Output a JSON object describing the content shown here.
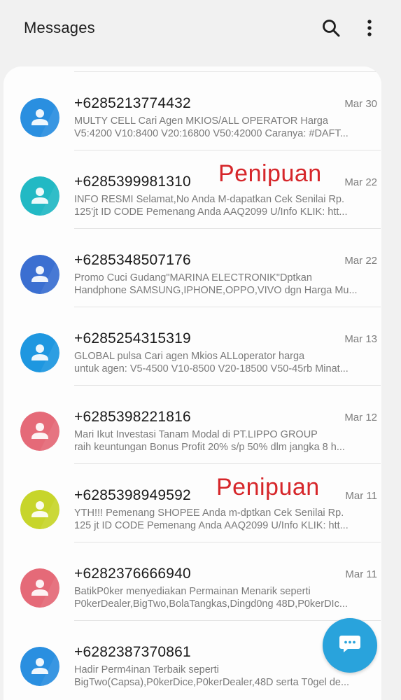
{
  "header": {
    "title": "Messages",
    "search_icon": "search-icon",
    "more_icon": "more-options-icon"
  },
  "conversations": [
    {
      "sender": "+6285213774432",
      "date": "Mar 30",
      "preview_line1": "MULTY CELL Cari Agen MKIOS/ALL OPERATOR Harga",
      "preview_line2": "V5:4200 V10:8400 V20:16800 V50:42000 Caranya: #DAFT...",
      "avatar_color": "#2a8fe0",
      "annotation": ""
    },
    {
      "sender": "+6285399981310",
      "date": "Mar 22",
      "preview_line1": "INFO RESMI Selamat,No Anda M-dapatkan Cek Senilai Rp.",
      "preview_line2": "125'jt ID CODE Pemenang Anda AAQ2099 U/Info KLIK: htt...",
      "avatar_color": "#22b9c4",
      "annotation": "Penipuan"
    },
    {
      "sender": "+6285348507176",
      "date": "Mar 22",
      "preview_line1": "Promo Cuci Gudang\"MARINA ELECTRONIK\"Dptkan",
      "preview_line2": "Handphone SAMSUNG,IPHONE,OPPO,VIVO dgn Harga Mu...",
      "avatar_color": "#3b6fd1",
      "annotation": ""
    },
    {
      "sender": "+6285254315319",
      "date": "Mar 13",
      "preview_line1": "GLOBAL pulsa Cari agen Mkios  ALLoperator harga",
      "preview_line2": "untuk agen: V5-4500 V10-8500 V20-18500 V50-45rb Minat...",
      "avatar_color": "#1e97e0",
      "annotation": ""
    },
    {
      "sender": "+6285398221816",
      "date": "Mar 12",
      "preview_line1": "Mari Ikut Investasi Tanam Modal di PT.LIPPO GROUP",
      "preview_line2": "raih keuntungan Bonus Profit 20% s/p 50% dlm jangka 8 h...",
      "avatar_color": "#e56a78",
      "annotation": ""
    },
    {
      "sender": "+6285398949592",
      "date": "Mar 11",
      "preview_line1": "YTH!!! Pemenang SHOPEE Anda m-dptkan Cek Senilai Rp.",
      "preview_line2": "125 jt ID CODE Pemenang Anda AAQ2099 U/Info KLIK: htt...",
      "avatar_color": "#c7d52b",
      "annotation": "Penipuan"
    },
    {
      "sender": "+6282376666940",
      "date": "Mar 11",
      "preview_line1": "BatikP0ker menyediakan Permainan Menarik seperti",
      "preview_line2": "P0kerDealer,BigTwo,BolaTangkas,Dingd0ng 48D,P0kerDIc...",
      "avatar_color": "#e56a78",
      "annotation": ""
    },
    {
      "sender": "+6282387370861",
      "date": "",
      "preview_line1": "Hadir Perm4inan Terbaik seperti",
      "preview_line2": "BigTwo(Capsa),P0kerDice,P0kerDealer,48D serta T0gel de...",
      "avatar_color": "#2a8fe0",
      "annotation": ""
    }
  ],
  "fab": {
    "icon": "compose-message-icon",
    "color": "#29a3dc"
  }
}
